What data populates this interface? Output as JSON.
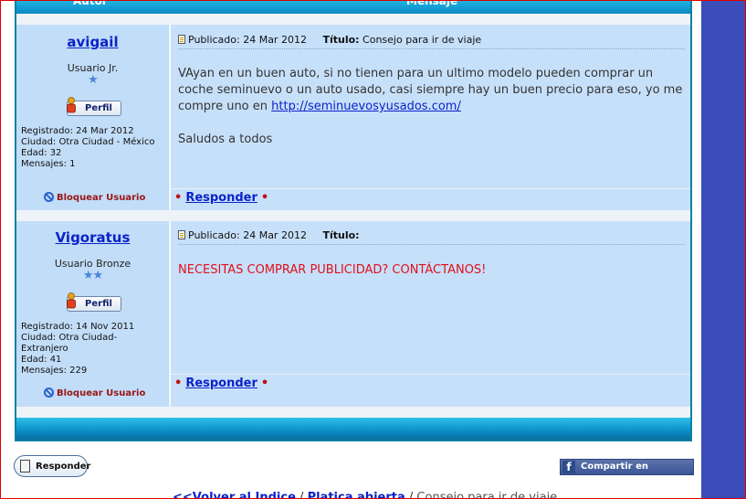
{
  "table_header": {
    "author_col": "Autor",
    "message_col": "Mensaje"
  },
  "posts": [
    {
      "author": "avigail",
      "rank": "Usuario Jr.",
      "stars": "★",
      "profile_label": "Perfil",
      "registered": "Registrado: 24 Mar 2012",
      "city": "Ciudad: Otra Ciudad - México",
      "age": "Edad: 32",
      "messages": "Mensajes: 1",
      "block_label": "Bloquear Usuario",
      "published": "Publicado: 24 Mar 2012",
      "title_label": "Título:",
      "title_value": "Consejo para ir de viaje",
      "body_text": "VAyan en un buen auto, si no tienen para un ultimo modelo pueden comprar un coche seminuevo o un auto usado, casi siempre hay un buen precio para eso, yo me compre uno en ",
      "body_link": "http://seminuevosyusados.com/",
      "body_closing": "Saludos a todos",
      "reply_label": "Responder"
    },
    {
      "author": "Vigoratus",
      "rank": "Usuario Bronze",
      "stars": "★★",
      "profile_label": "Perfil",
      "registered": "Registrado: 14 Nov 2011",
      "city": "Ciudad: Otra Ciudad- Extranjero",
      "age": "Edad: 41",
      "messages": "Mensajes: 229",
      "block_label": "Bloquear Usuario",
      "published": "Publicado: 24 Mar 2012",
      "title_label": "Título:",
      "title_value": "",
      "body_text": "NECESITAS COMPRAR PUBLICIDAD? CONTÁCTANOS!",
      "reply_label": "Responder"
    }
  ],
  "bottom": {
    "reply_button": "Responder",
    "facebook_share": "Compartir en Facebook",
    "nav_back": "<<Volver al Indice",
    "nav_sep": "/",
    "nav_forum": "Platica abierta",
    "nav_current": "Consejo para ir de viaje"
  },
  "colors": {
    "accent_blue": "#0b23c8",
    "header_cyan": "#1fb2e0",
    "block_red": "#9a1515",
    "spam_red": "#e0101a",
    "sidebar_blue": "#3a4db8"
  },
  "icons": {
    "profile": "person-icon",
    "block": "block-icon",
    "post": "document-icon",
    "reply": "notepad-icon",
    "facebook": "facebook-icon"
  }
}
